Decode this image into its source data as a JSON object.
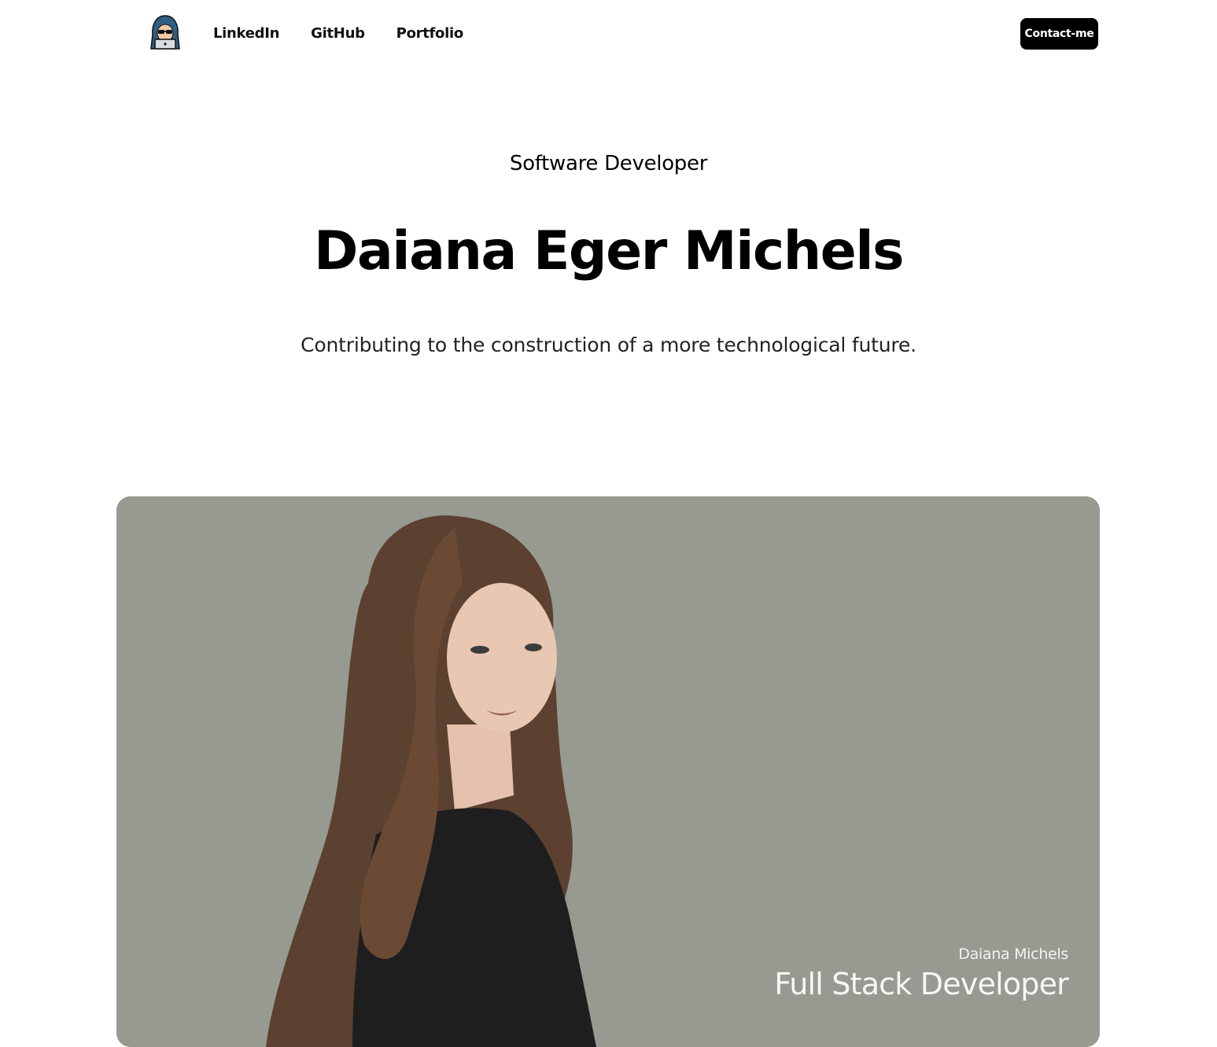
{
  "nav": {
    "logo_icon": "hacker-avatar-icon",
    "links": [
      {
        "label": "LinkedIn"
      },
      {
        "label": "GitHub"
      },
      {
        "label": "Portfolio"
      }
    ],
    "contact_label": "Contact-me"
  },
  "hero": {
    "subtitle": "Software Developer",
    "title": "Daiana Eger Michels",
    "tagline": "Contributing to the construction of a more technological future."
  },
  "photo": {
    "caption_name": "Daiana Michels",
    "caption_role": "Full Stack Developer",
    "background_color": "#979a90"
  },
  "colors": {
    "button_bg": "#000000",
    "button_text": "#ffffff"
  }
}
